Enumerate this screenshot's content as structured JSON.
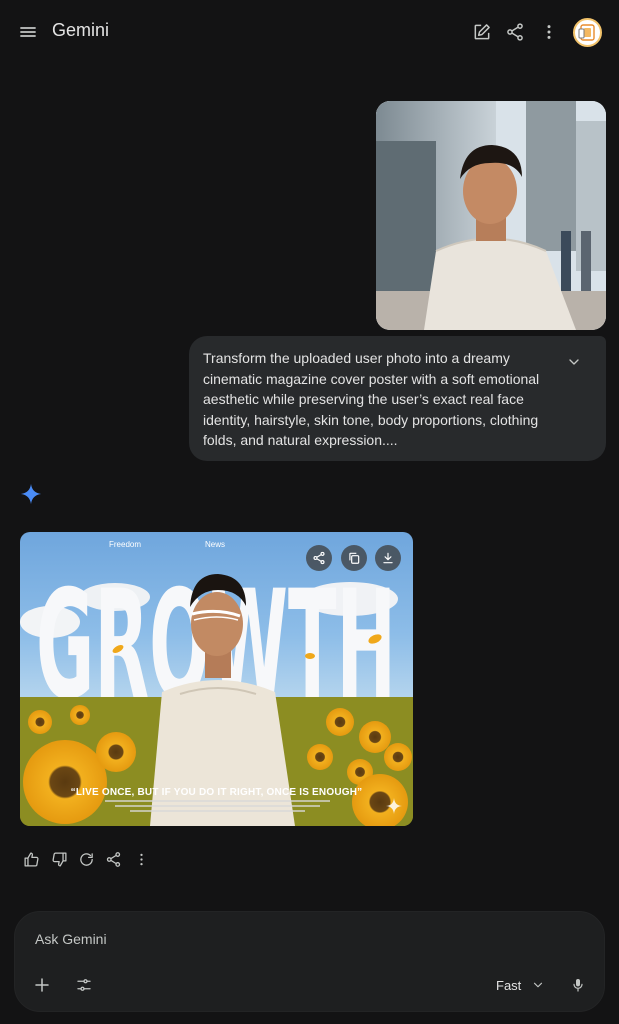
{
  "header": {
    "app_title": "Gemini",
    "icons": [
      "menu-icon",
      "new-chat-icon",
      "share-icon",
      "more-vert-icon"
    ],
    "avatar": "account-avatar"
  },
  "chat": {
    "user_prompt": "Transform the uploaded user photo into a dreamy cinematic magazine cover poster with a soft emotional aesthetic while preserving the user’s exact real face identity, hairstyle, skin tone, body proportions, clothing folds, and natural expression....",
    "poster": {
      "nav_left": "Freedom",
      "nav_right": "News",
      "headline": "GROWTH",
      "quote": "“LIVE ONCE, BUT IF YOU DO IT RIGHT, ONCE IS ENOUGH”",
      "actions": [
        "share-icon",
        "copy-icon",
        "download-icon"
      ]
    },
    "reactions": [
      "thumb-up-icon",
      "thumb-down-icon",
      "regenerate-icon",
      "share-icon",
      "more-vert-icon"
    ]
  },
  "composer": {
    "placeholder": "Ask Gemini",
    "mode_label": "Fast",
    "icons": [
      "add-icon",
      "tools-icon",
      "chevron-down-icon",
      "mic-icon"
    ]
  },
  "colors": {
    "background": "#131314",
    "bubble": "#282a2c",
    "composer": "#1e1f20",
    "text": "#e3e3e3",
    "spark_blue": "#4a8cf7"
  }
}
